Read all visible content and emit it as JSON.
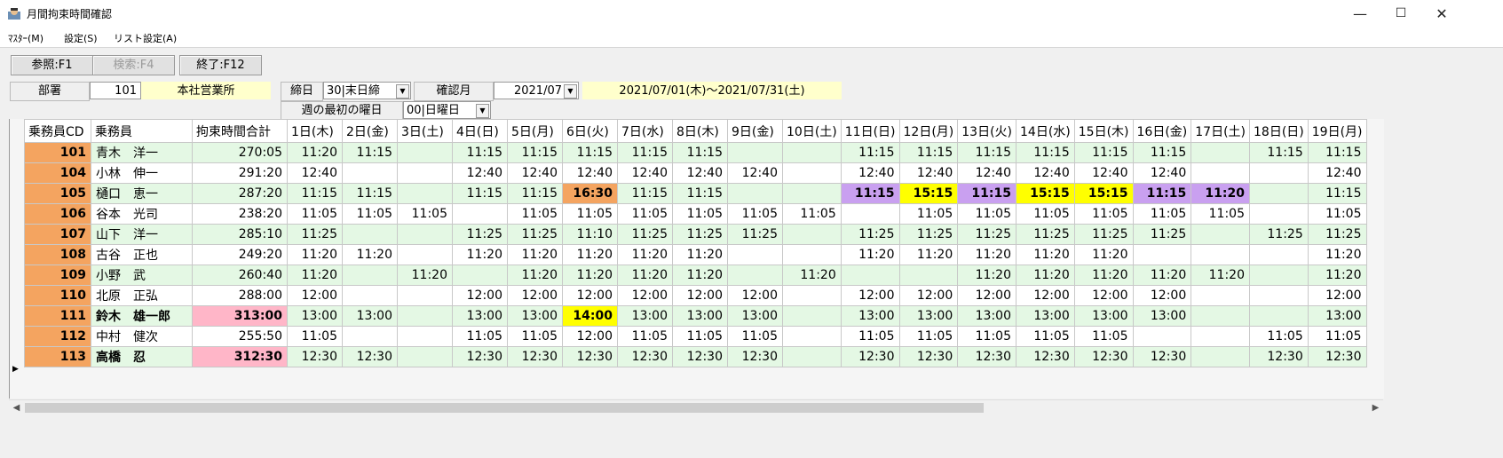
{
  "window": {
    "title": "月間拘束時間確認",
    "minimize": "—",
    "maximize": "☐",
    "close": "✕"
  },
  "menu": [
    "ﾏｽﾀｰ(M)",
    "設定(S)",
    "リスト設定(A)"
  ],
  "fkeys": {
    "ref": "参照:F1",
    "search": "検索:F4",
    "exit": "終了:F12"
  },
  "form": {
    "dept_label": "部署",
    "dept_code": "101",
    "dept_name": "本社営業所",
    "close_label": "締日",
    "close_value": "30|末日締",
    "month_label": "確認月",
    "month_value": "2021/07",
    "period": "2021/07/01(木)～2021/07/31(土)",
    "week_label": "週の最初の曜日",
    "week_value": "00|日曜日"
  },
  "grid": {
    "headers": [
      "乗務員CD",
      "乗務員",
      "拘束時間合計",
      "1日(木)",
      "2日(金)",
      "3日(土)",
      "4日(日)",
      "5日(月)",
      "6日(火)",
      "7日(水)",
      "8日(木)",
      "9日(金)",
      "10日(土)",
      "11日(日)",
      "12日(月)",
      "13日(火)",
      "14日(水)",
      "15日(木)",
      "16日(金)",
      "17日(土)",
      "18日(日)",
      "19日(月)"
    ],
    "rows": [
      {
        "cd": "101",
        "name": "青木　洋一",
        "total": "270:05",
        "days": [
          "11:20",
          "11:15",
          "",
          "11:15",
          "11:15",
          "11:15",
          "11:15",
          "11:15",
          "",
          "",
          "11:15",
          "11:15",
          "11:15",
          "11:15",
          "11:15",
          "11:15",
          "",
          "11:15",
          "11:15"
        ]
      },
      {
        "cd": "104",
        "name": "小林　伸一",
        "total": "291:20",
        "days": [
          "12:40",
          "",
          "",
          "12:40",
          "12:40",
          "12:40",
          "12:40",
          "12:40",
          "12:40",
          "",
          "12:40",
          "12:40",
          "12:40",
          "12:40",
          "12:40",
          "12:40",
          "",
          "",
          "12:40"
        ]
      },
      {
        "cd": "105",
        "name": "樋口　恵一",
        "total": "287:20",
        "days": [
          "11:15",
          "11:15",
          "",
          "11:15",
          "11:15",
          "16:30",
          "11:15",
          "11:15",
          "",
          "",
          "11:15",
          "15:15",
          "11:15",
          "15:15",
          "15:15",
          "11:15",
          "11:20",
          "",
          "11:15"
        ]
      },
      {
        "cd": "106",
        "name": "谷本　光司",
        "total": "238:20",
        "days": [
          "11:05",
          "11:05",
          "11:05",
          "",
          "11:05",
          "11:05",
          "11:05",
          "11:05",
          "11:05",
          "11:05",
          "",
          "11:05",
          "11:05",
          "11:05",
          "11:05",
          "11:05",
          "11:05",
          "",
          "11:05"
        ]
      },
      {
        "cd": "107",
        "name": "山下　洋一",
        "total": "285:10",
        "days": [
          "11:25",
          "",
          "",
          "11:25",
          "11:25",
          "11:10",
          "11:25",
          "11:25",
          "11:25",
          "",
          "11:25",
          "11:25",
          "11:25",
          "11:25",
          "11:25",
          "11:25",
          "",
          "11:25",
          "11:25"
        ]
      },
      {
        "cd": "108",
        "name": "古谷　正也",
        "total": "249:20",
        "days": [
          "11:20",
          "11:20",
          "",
          "11:20",
          "11:20",
          "11:20",
          "11:20",
          "11:20",
          "",
          "",
          "11:20",
          "11:20",
          "11:20",
          "11:20",
          "11:20",
          "",
          "",
          "",
          "11:20"
        ]
      },
      {
        "cd": "109",
        "name": "小野　武",
        "total": "260:40",
        "days": [
          "11:20",
          "",
          "11:20",
          "",
          "11:20",
          "11:20",
          "11:20",
          "11:20",
          "",
          "11:20",
          "",
          "",
          "11:20",
          "11:20",
          "11:20",
          "11:20",
          "11:20",
          "",
          "11:20"
        ]
      },
      {
        "cd": "110",
        "name": "北原　正弘",
        "total": "288:00",
        "days": [
          "12:00",
          "",
          "",
          "12:00",
          "12:00",
          "12:00",
          "12:00",
          "12:00",
          "12:00",
          "",
          "12:00",
          "12:00",
          "12:00",
          "12:00",
          "12:00",
          "12:00",
          "",
          "",
          "12:00"
        ]
      },
      {
        "cd": "111",
        "name": "鈴木　雄一郎",
        "total": "313:00",
        "days": [
          "13:00",
          "13:00",
          "",
          "13:00",
          "13:00",
          "14:00",
          "13:00",
          "13:00",
          "13:00",
          "",
          "13:00",
          "13:00",
          "13:00",
          "13:00",
          "13:00",
          "13:00",
          "",
          "",
          "13:00"
        ]
      },
      {
        "cd": "112",
        "name": "中村　健次",
        "total": "255:50",
        "days": [
          "11:05",
          "",
          "",
          "11:05",
          "11:05",
          "12:00",
          "11:05",
          "11:05",
          "11:05",
          "",
          "11:05",
          "11:05",
          "11:05",
          "11:05",
          "11:05",
          "",
          "",
          "11:05",
          "11:05"
        ]
      },
      {
        "cd": "113",
        "name": "高橋　忍",
        "total": "312:30",
        "days": [
          "12:30",
          "12:30",
          "",
          "12:30",
          "12:30",
          "12:30",
          "12:30",
          "12:30",
          "12:30",
          "",
          "12:30",
          "12:30",
          "12:30",
          "12:30",
          "12:30",
          "12:30",
          "",
          "12:30",
          "12:30"
        ]
      }
    ]
  },
  "highlights": {
    "row_total_pink": [
      "111",
      "113"
    ],
    "cells": [
      {
        "row": "105",
        "day": 6,
        "color": "orange"
      },
      {
        "row": "105",
        "day": 11,
        "color": "purple"
      },
      {
        "row": "105",
        "day": 12,
        "color": "yellow"
      },
      {
        "row": "105",
        "day": 13,
        "color": "purple"
      },
      {
        "row": "105",
        "day": 14,
        "color": "yellow"
      },
      {
        "row": "105",
        "day": 15,
        "color": "yellow"
      },
      {
        "row": "105",
        "day": 16,
        "color": "purple"
      },
      {
        "row": "105",
        "day": 17,
        "color": "purple"
      },
      {
        "row": "111",
        "day": 6,
        "color": "yellow"
      }
    ],
    "colors": {
      "orange": "#f4a460",
      "purple": "#c9a0f0",
      "yellow": "#ffff00",
      "pink": "#ffb6c8",
      "green": "#e4f8e4"
    }
  },
  "selected_row": "113"
}
